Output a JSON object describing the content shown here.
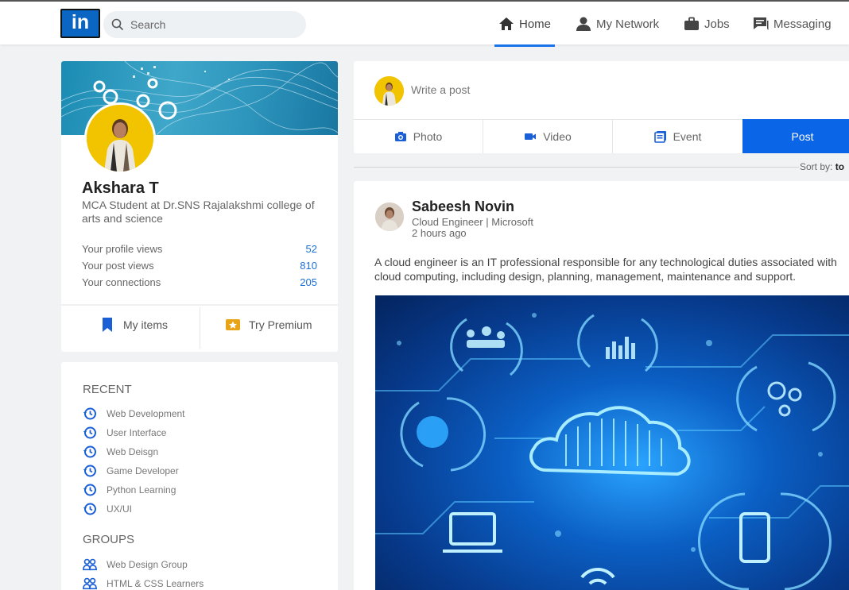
{
  "header": {
    "logo_text": "in",
    "search_placeholder": "Search",
    "nav": [
      {
        "label": "Home",
        "icon": "home-icon",
        "active": true
      },
      {
        "label": "My Network",
        "icon": "network-icon"
      },
      {
        "label": "Jobs",
        "icon": "briefcase-icon"
      },
      {
        "label": "Messaging",
        "icon": "messaging-icon"
      }
    ]
  },
  "profile": {
    "name": "Akshara T",
    "headline": "MCA Student at Dr.SNS Rajalakshmi college of arts and science",
    "stats": [
      {
        "label": "Your profile views",
        "value": "52"
      },
      {
        "label": "Your post views",
        "value": "810"
      },
      {
        "label": "Your connections",
        "value": "205"
      }
    ],
    "my_items_label": "My items",
    "premium_label": "Try Premium"
  },
  "sidebar": {
    "recent_title": "RECENT",
    "recent_items": [
      "Web Development",
      "User Interface",
      "Web Deisgn",
      "Game Developer",
      "Python Learning",
      "UX/UI"
    ],
    "groups_title": "GROUPS",
    "groups": [
      "Web Design Group",
      "HTML & CSS Learners"
    ]
  },
  "composer": {
    "placeholder": "Write a post",
    "tabs": [
      {
        "label": "Photo",
        "icon": "camera-icon"
      },
      {
        "label": "Video",
        "icon": "video-icon"
      },
      {
        "label": "Event",
        "icon": "event-icon"
      }
    ],
    "post_label": "Post"
  },
  "feed": {
    "sort_label": "Sort by:",
    "sort_value": "to",
    "post": {
      "author": "Sabeesh Novin",
      "role": "Cloud Engineer | Microsoft",
      "time": "2 hours ago",
      "text": "A cloud engineer is an IT professional responsible for any technological duties associated with cloud computing, including design, planning, management, maintenance and support."
    }
  },
  "colors": {
    "accent": "#0a66e6",
    "logo_blue": "#0a66c2",
    "stat_blue": "#1a6fd8",
    "avatar_yellow": "#f2c400",
    "premium_gold": "#e8a317"
  }
}
